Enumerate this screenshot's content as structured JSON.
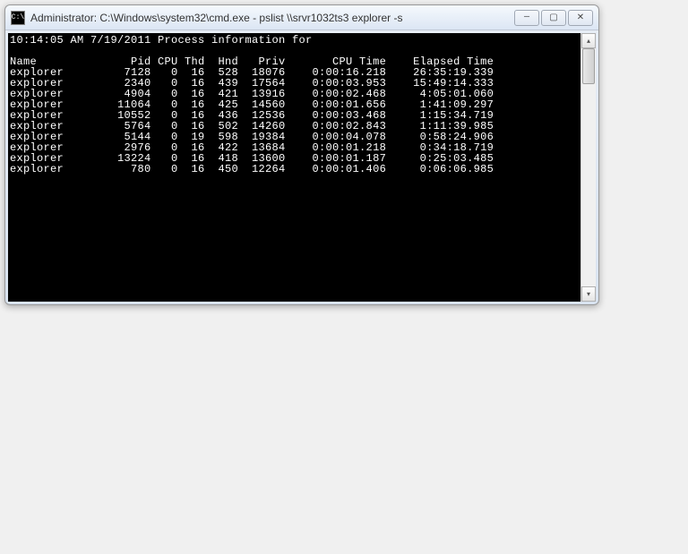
{
  "window": {
    "title": "Administrator: C:\\Windows\\system32\\cmd.exe - pslist  \\\\srvr1032ts3 explorer -s",
    "icon_label": "C:\\"
  },
  "console": {
    "timestamp_line": "10:14:05 AM 7/19/2011 Process information for",
    "headers": {
      "name": "Name",
      "pid": "Pid",
      "cpu": "CPU",
      "thd": "Thd",
      "hnd": "Hnd",
      "priv": "Priv",
      "cpu_time": "CPU Time",
      "elapsed": "Elapsed Time"
    },
    "rows": [
      {
        "name": "explorer",
        "pid": "7128",
        "cpu": "0",
        "thd": "16",
        "hnd": "528",
        "priv": "18076",
        "cpu_time": "0:00:16.218",
        "elapsed": "26:35:19.339"
      },
      {
        "name": "explorer",
        "pid": "2340",
        "cpu": "0",
        "thd": "16",
        "hnd": "439",
        "priv": "17564",
        "cpu_time": "0:00:03.953",
        "elapsed": "15:49:14.333"
      },
      {
        "name": "explorer",
        "pid": "4904",
        "cpu": "0",
        "thd": "16",
        "hnd": "421",
        "priv": "13916",
        "cpu_time": "0:00:02.468",
        "elapsed": "4:05:01.060"
      },
      {
        "name": "explorer",
        "pid": "11064",
        "cpu": "0",
        "thd": "16",
        "hnd": "425",
        "priv": "14560",
        "cpu_time": "0:00:01.656",
        "elapsed": "1:41:09.297"
      },
      {
        "name": "explorer",
        "pid": "10552",
        "cpu": "0",
        "thd": "16",
        "hnd": "436",
        "priv": "12536",
        "cpu_time": "0:00:03.468",
        "elapsed": "1:15:34.719"
      },
      {
        "name": "explorer",
        "pid": "5764",
        "cpu": "0",
        "thd": "16",
        "hnd": "502",
        "priv": "14260",
        "cpu_time": "0:00:02.843",
        "elapsed": "1:11:39.985"
      },
      {
        "name": "explorer",
        "pid": "5144",
        "cpu": "0",
        "thd": "19",
        "hnd": "598",
        "priv": "19384",
        "cpu_time": "0:00:04.078",
        "elapsed": "0:58:24.906"
      },
      {
        "name": "explorer",
        "pid": "2976",
        "cpu": "0",
        "thd": "16",
        "hnd": "422",
        "priv": "13684",
        "cpu_time": "0:00:01.218",
        "elapsed": "0:34:18.719"
      },
      {
        "name": "explorer",
        "pid": "13224",
        "cpu": "0",
        "thd": "16",
        "hnd": "418",
        "priv": "13600",
        "cpu_time": "0:00:01.187",
        "elapsed": "0:25:03.485"
      },
      {
        "name": "explorer",
        "pid": "780",
        "cpu": "0",
        "thd": "16",
        "hnd": "450",
        "priv": "12264",
        "cpu_time": "0:00:01.406",
        "elapsed": "0:06:06.985"
      }
    ]
  },
  "controls": {
    "minimize": "—",
    "maximize": "▢",
    "close": "✕",
    "scroll_up": "▴",
    "scroll_down": "▾"
  }
}
